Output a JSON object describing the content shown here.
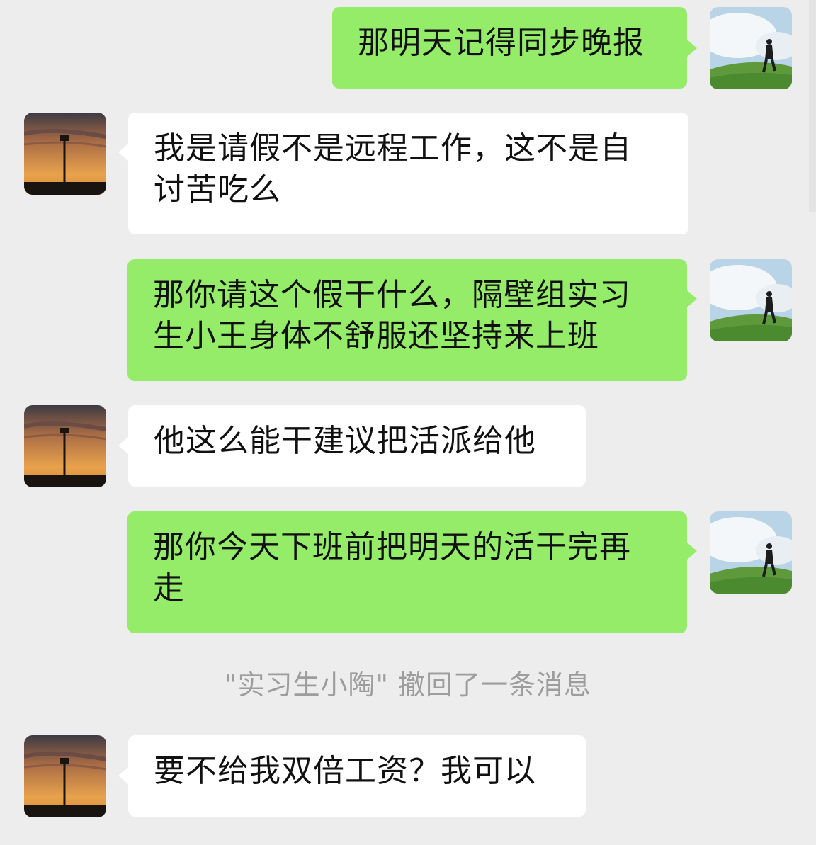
{
  "messages": [
    {
      "sender": "me",
      "text": "那明天记得同步晚报"
    },
    {
      "sender": "them",
      "text": "我是请假不是远程工作，这不是自讨苦吃么"
    },
    {
      "sender": "me",
      "text": "那你请这个假干什么，隔壁组实习生小王身体不舒服还坚持来上班"
    },
    {
      "sender": "them",
      "text": "他这么能干建议把活派给他"
    },
    {
      "sender": "me",
      "text": "那你今天下班前把明天的活干完再走"
    },
    {
      "sender": "them",
      "text": "要不给我双倍工资？我可以"
    }
  ],
  "system_notice": "\"实习生小陶\" 撤回了一条消息",
  "avatars": {
    "me": "avatar-person-on-hill-icon",
    "them": "avatar-sunset-tower-icon"
  },
  "colors": {
    "background": "#ededed",
    "my_bubble": "#95ec69",
    "their_bubble": "#ffffff",
    "system_text": "#9d9d9d"
  }
}
